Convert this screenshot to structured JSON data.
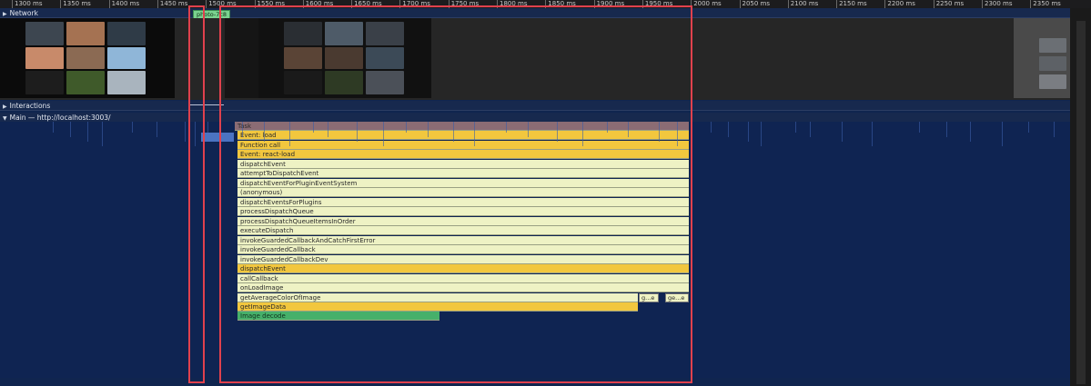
{
  "ruler": {
    "ticks": [
      "1300 ms",
      "1350 ms",
      "1400 ms",
      "1450 ms",
      "1500 ms",
      "1550 ms",
      "1600 ms",
      "1650 ms",
      "1700 ms",
      "1750 ms",
      "1800 ms",
      "1850 ms",
      "1900 ms",
      "1950 ms",
      "2000 ms",
      "2050 ms",
      "2100 ms",
      "2150 ms",
      "2200 ms",
      "2250 ms",
      "2300 ms",
      "2350 ms"
    ]
  },
  "tracks": {
    "network_label": "Network",
    "network_chip": "photo-7c8",
    "interactions_label": "Interactions",
    "main_label": "Main — http://localhost:3003/"
  },
  "flame": {
    "task": "Task",
    "rows": [
      {
        "label": "Event: load",
        "kind": "yellow"
      },
      {
        "label": "Function call",
        "kind": "yellow"
      },
      {
        "label": "Event: react-load",
        "kind": "yellow"
      },
      {
        "label": "dispatchEvent",
        "kind": "light"
      },
      {
        "label": "attemptToDispatchEvent",
        "kind": "light"
      },
      {
        "label": "dispatchEventForPluginEventSystem",
        "kind": "light"
      },
      {
        "label": "(anonymous)",
        "kind": "light"
      },
      {
        "label": "dispatchEventsForPlugins",
        "kind": "light"
      },
      {
        "label": "processDispatchQueue",
        "kind": "light"
      },
      {
        "label": "processDispatchQueueItemsInOrder",
        "kind": "light"
      },
      {
        "label": "executeDispatch",
        "kind": "light"
      },
      {
        "label": "invokeGuardedCallbackAndCatchFirstError",
        "kind": "light"
      },
      {
        "label": "invokeGuardedCallback",
        "kind": "light"
      },
      {
        "label": "invokeGuardedCallbackDev",
        "kind": "light"
      },
      {
        "label": "dispatchEvent",
        "kind": "yellow"
      },
      {
        "label": "callCallback",
        "kind": "light"
      },
      {
        "label": "onLoadImage",
        "kind": "light"
      },
      {
        "label": "getAverageColorOfImage",
        "kind": "light"
      }
    ],
    "get_image_data": "getImageData",
    "image_decode": "Image decode",
    "small_box_1": "g...e",
    "small_box_2": "ge...e"
  },
  "colors": {
    "selection": "#e0414d",
    "yellow": "#f2c73e",
    "light": "#eef2c4",
    "green": "#46b06a"
  }
}
